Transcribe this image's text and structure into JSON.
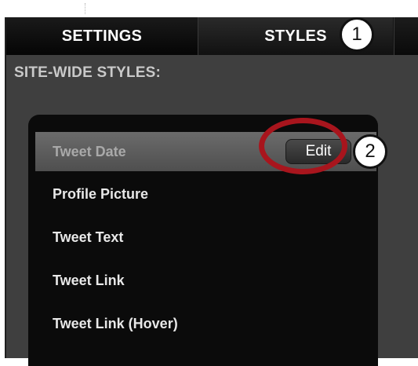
{
  "tabs": {
    "settings": "SETTINGS",
    "styles": "STYLES"
  },
  "section": {
    "title": "SITE-WIDE STYLES:"
  },
  "style_list": {
    "items": [
      {
        "label": "Tweet Date",
        "selected": true
      },
      {
        "label": "Profile Picture",
        "selected": false
      },
      {
        "label": "Tweet Text",
        "selected": false
      },
      {
        "label": "Tweet Link",
        "selected": false
      },
      {
        "label": "Tweet Link (Hover)",
        "selected": false
      }
    ],
    "edit_label": "Edit"
  },
  "annotations": {
    "callout_1": "1",
    "callout_2": "2",
    "ring_color": "#a8151d"
  },
  "colors": {
    "panel_bg": "#3f3f3f",
    "list_bg": "#0b0b0b",
    "selected_row": "#5e5e5e"
  }
}
